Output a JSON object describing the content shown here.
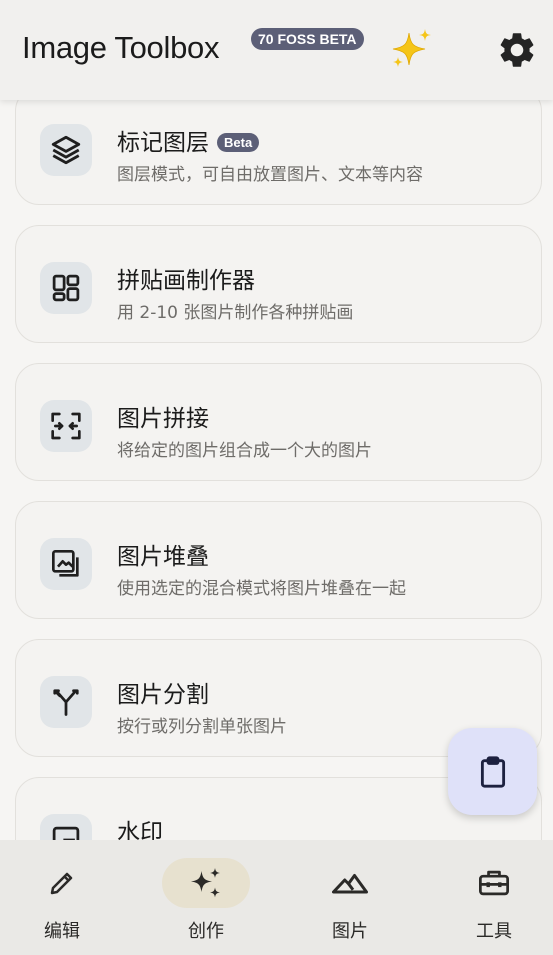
{
  "app": {
    "title": "Image Toolbox",
    "version_badge": "70 FOSS BETA",
    "sparkles_icon": "sparkles-icon",
    "settings_icon": "gear-icon"
  },
  "tools": [
    {
      "title": "标记图层",
      "badge": "Beta",
      "description": "图层模式，可自由放置图片、文本等内容",
      "icon": "layers-icon"
    },
    {
      "title": "拼贴画制作器",
      "description": "用 2-10 张图片制作各种拼贴画",
      "icon": "collage-icon"
    },
    {
      "title": "图片拼接",
      "description": "将给定的图片组合成一个大的图片",
      "icon": "stitch-icon"
    },
    {
      "title": "图片堆叠",
      "description": "使用选定的混合模式将图片堆叠在一起",
      "icon": "stack-icon"
    },
    {
      "title": "图片分割",
      "description": "按行或列分割单张图片",
      "icon": "split-icon"
    },
    {
      "title": "水印",
      "description": "",
      "icon": "watermark-icon"
    }
  ],
  "fab": {
    "icon": "clipboard-icon"
  },
  "bottom_nav": [
    {
      "label": "编辑",
      "icon": "pencil-icon",
      "active": false
    },
    {
      "label": "创作",
      "icon": "sparkle-icon",
      "active": true
    },
    {
      "label": "图片",
      "icon": "mountains-icon",
      "active": false
    },
    {
      "label": "工具",
      "icon": "toolbox-icon",
      "active": false
    }
  ],
  "colors": {
    "badge": "#5c5f77",
    "fab": "#dfe1f9",
    "icon_box": "#e1e5e8",
    "nav_active": "#e7e1cf"
  }
}
